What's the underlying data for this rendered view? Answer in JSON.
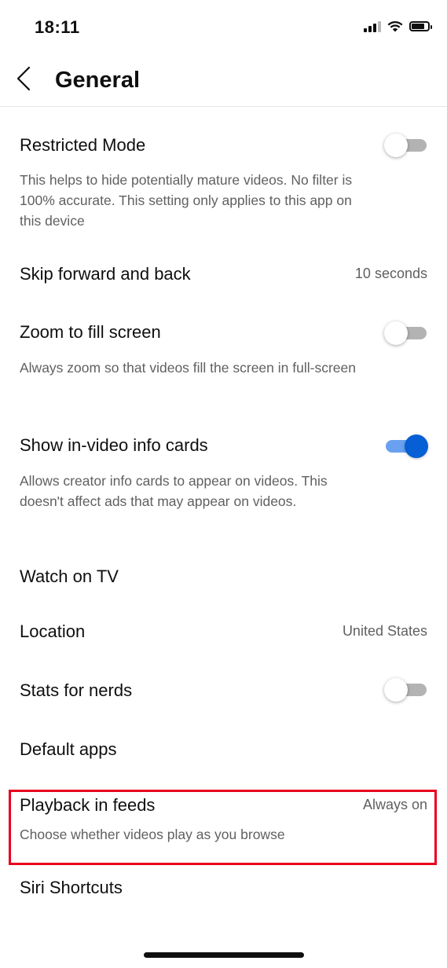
{
  "status_bar": {
    "time": "18:11"
  },
  "header": {
    "title": "General",
    "back_icon": "chevron-left-icon"
  },
  "settings": {
    "restricted_mode": {
      "title": "Restricted Mode",
      "description": "This helps to hide potentially mature videos. No filter is 100% accurate. This setting only applies to this app on this device",
      "enabled": false
    },
    "skip": {
      "title": "Skip forward and back",
      "value": "10 seconds"
    },
    "zoom": {
      "title": "Zoom to fill screen",
      "description": "Always zoom so that videos fill the screen in full-screen",
      "enabled": false
    },
    "info_cards": {
      "title": "Show in-video info cards",
      "description": "Allows creator info cards to appear on videos. This doesn't affect ads that may appear on videos.",
      "enabled": true
    },
    "watch_on_tv": {
      "title": "Watch on TV"
    },
    "location": {
      "title": "Location",
      "value": "United States"
    },
    "stats_for_nerds": {
      "title": "Stats for nerds",
      "enabled": false
    },
    "default_apps": {
      "title": "Default apps"
    },
    "playback_in_feeds": {
      "title": "Playback in feeds",
      "value": "Always on",
      "description": "Choose whether videos play as you browse",
      "highlighted": true
    },
    "siri_shortcuts": {
      "title": "Siri Shortcuts"
    }
  },
  "colors": {
    "accent": "#065fd4",
    "highlight_border": "#e8001c",
    "secondary_text": "#606060"
  }
}
